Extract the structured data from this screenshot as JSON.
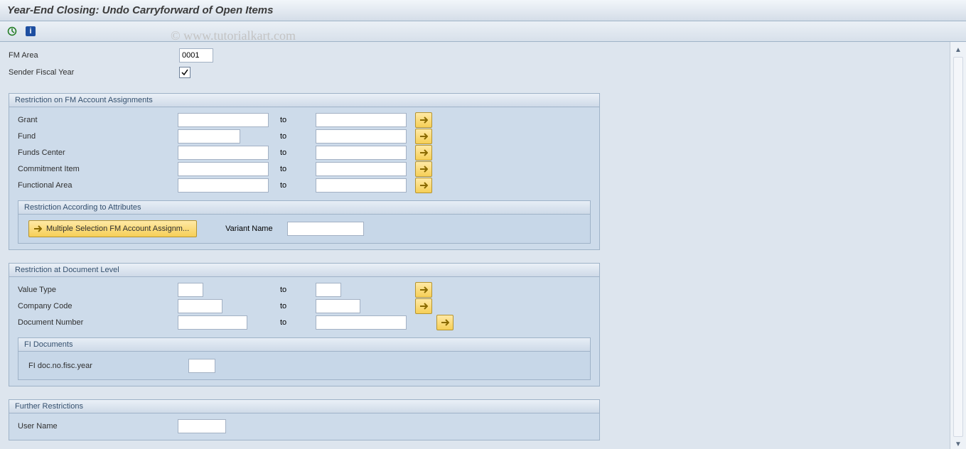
{
  "title": "Year-End Closing: Undo Carryforward of Open Items",
  "watermark": "© www.tutorialkart.com",
  "top": {
    "fm_area_label": "FM Area",
    "fm_area_value": "0001",
    "fiscal_year_label": "Sender Fiscal Year"
  },
  "group_fm": {
    "title": "Restriction on FM Account Assignments",
    "rows": {
      "grant": {
        "label": "Grant",
        "to": "to"
      },
      "fund": {
        "label": "Fund",
        "to": "to"
      },
      "fundsctr": {
        "label": "Funds Center",
        "to": "to"
      },
      "cmmtitem": {
        "label": "Commitment Item",
        "to": "to"
      },
      "funcarea": {
        "label": "Functional Area",
        "to": "to"
      }
    },
    "attr_sub": {
      "title": "Restriction According to Attributes",
      "button": "Multiple Selection FM Account Assignm...",
      "variant_label": "Variant Name"
    }
  },
  "group_doc": {
    "title": "Restriction at Document Level",
    "rows": {
      "valtype": {
        "label": "Value Type",
        "to": "to"
      },
      "company": {
        "label": "Company Code",
        "to": "to"
      },
      "docno": {
        "label": "Document Number",
        "to": "to"
      }
    },
    "fi_sub": {
      "title": "FI Documents",
      "row_label": "FI doc.no.fisc.year"
    }
  },
  "group_further": {
    "title": "Further Restrictions",
    "user_label": "User Name"
  }
}
